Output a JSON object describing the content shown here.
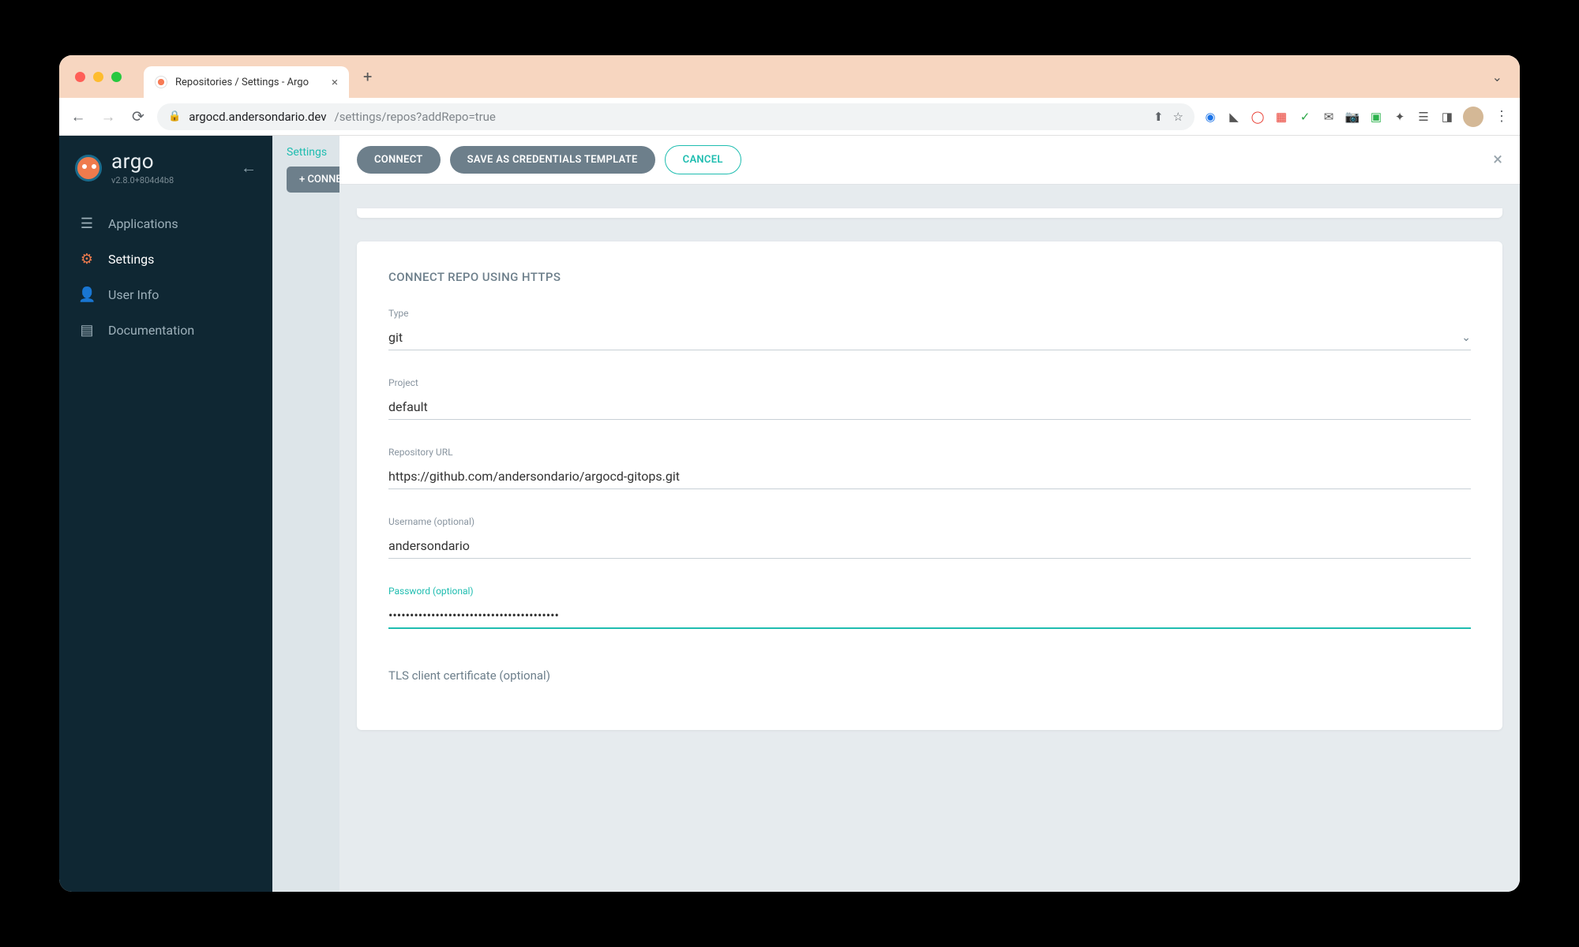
{
  "browser": {
    "tab_title": "Repositories / Settings - Argo",
    "url_host": "argocd.andersondario.dev",
    "url_path": "/settings/repos?addRepo=true"
  },
  "sidebar": {
    "brand": "argo",
    "version": "v2.8.0+804d4b8",
    "items": [
      {
        "icon": "layers",
        "label": "Applications"
      },
      {
        "icon": "gear",
        "label": "Settings"
      },
      {
        "icon": "user",
        "label": "User Info"
      },
      {
        "icon": "book",
        "label": "Documentation"
      }
    ]
  },
  "breadcrumb": {
    "settings": "Settings"
  },
  "subbar": {
    "connect_repo": "+ CONNECT REPO"
  },
  "panel": {
    "buttons": {
      "connect": "CONNECT",
      "save_template": "SAVE AS CREDENTIALS TEMPLATE",
      "cancel": "CANCEL"
    },
    "title": "CONNECT REPO USING HTTPS",
    "fields": {
      "type_label": "Type",
      "type_value": "git",
      "project_label": "Project",
      "project_value": "default",
      "repo_url_label": "Repository URL",
      "repo_url_value": "https://github.com/andersondario/argocd-gitops.git",
      "username_label": "Username (optional)",
      "username_value": "andersondario",
      "password_label": "Password (optional)",
      "password_value": "••••••••••••••••••••••••••••••••••••••••",
      "tls_label": "TLS client certificate (optional)"
    }
  }
}
